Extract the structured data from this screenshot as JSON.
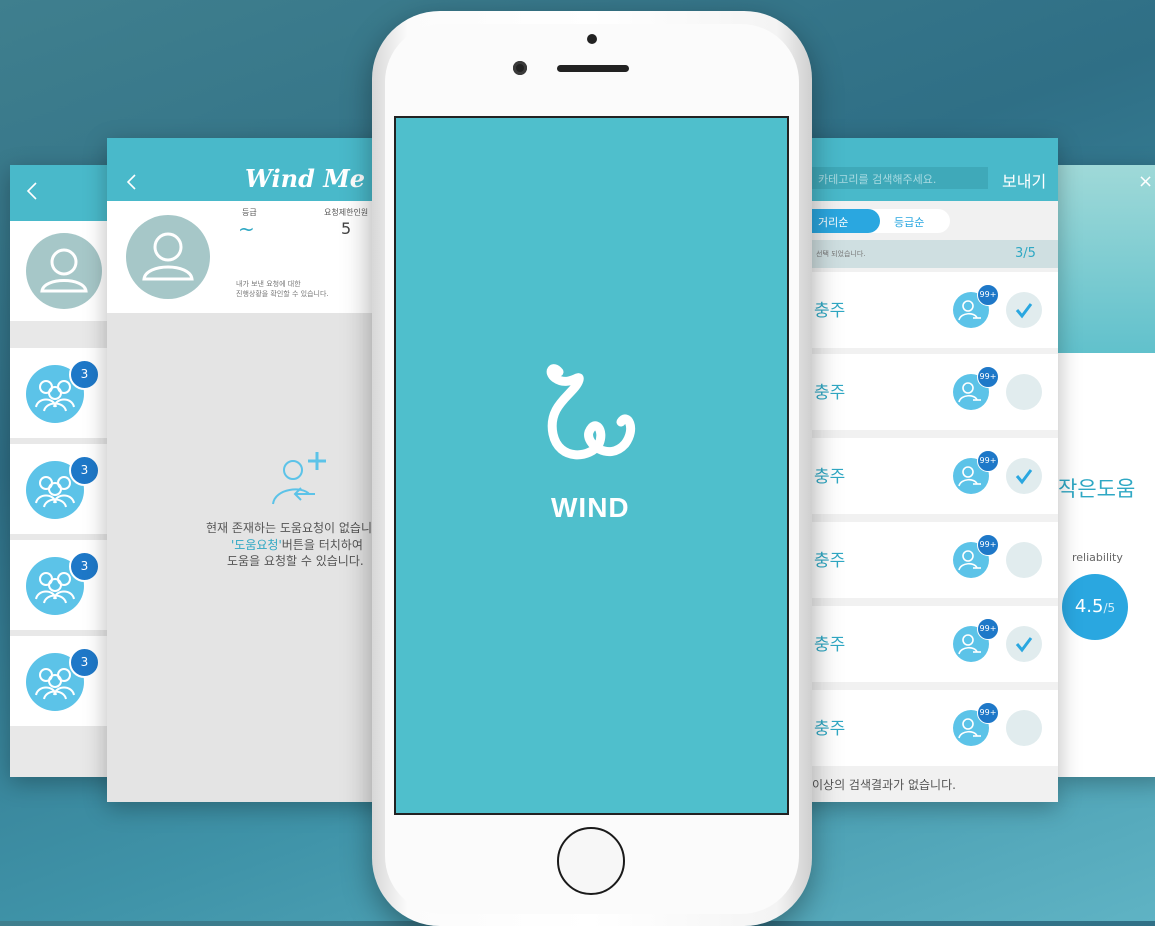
{
  "colors": {
    "teal_header": "#49b9ca",
    "splash_bg": "#4fbfcc",
    "accent_blue": "#1e78c8",
    "light_blue": "#5cc3e8"
  },
  "left_screen": {
    "back_icon": "chevron-left-icon",
    "groups": [
      {
        "badge": "3"
      },
      {
        "badge": "3"
      },
      {
        "badge": "3"
      },
      {
        "badge": "3"
      }
    ]
  },
  "request_screen": {
    "logo_text": "Wind Me",
    "grade_label": "등급",
    "grade_value": "~",
    "limit_label": "요청제한인원",
    "limit_value": "5",
    "profile_note_line1": "내가 보낸 요청에 대한",
    "profile_note_line2": "진행상황을 확인할 수 있습니다.",
    "empty_line1": "현재 존재하는 도움요청이 없습니",
    "empty_highlight": "'도움요청'",
    "empty_line2_rest": "버튼을 터치하여",
    "empty_line3": "도움을 요청할 수 있습니다."
  },
  "splash": {
    "brand": "WIND"
  },
  "search_screen": {
    "search_placeholder": "카테고리를 검색해주세요.",
    "send_label": "보내기",
    "sort_distance": "거리순",
    "sort_grade": "등급순",
    "selected_note": "선택 되었습니다.",
    "selected_count": "3/5",
    "rows": [
      {
        "label": "충주",
        "badge": "99+",
        "checked": true
      },
      {
        "label": "충주",
        "badge": "99+",
        "checked": false
      },
      {
        "label": "충주",
        "badge": "99+",
        "checked": true
      },
      {
        "label": "충주",
        "badge": "99+",
        "checked": false
      },
      {
        "label": "충주",
        "badge": "99+",
        "checked": true
      },
      {
        "label": "충주",
        "badge": "99+",
        "checked": false
      }
    ],
    "footer": "이상의 검색결과가 없습니다."
  },
  "right_screen": {
    "close_label": "×",
    "title": "작은도움",
    "reliability_label": "reliability",
    "score": "4.5",
    "score_max": "/5"
  }
}
